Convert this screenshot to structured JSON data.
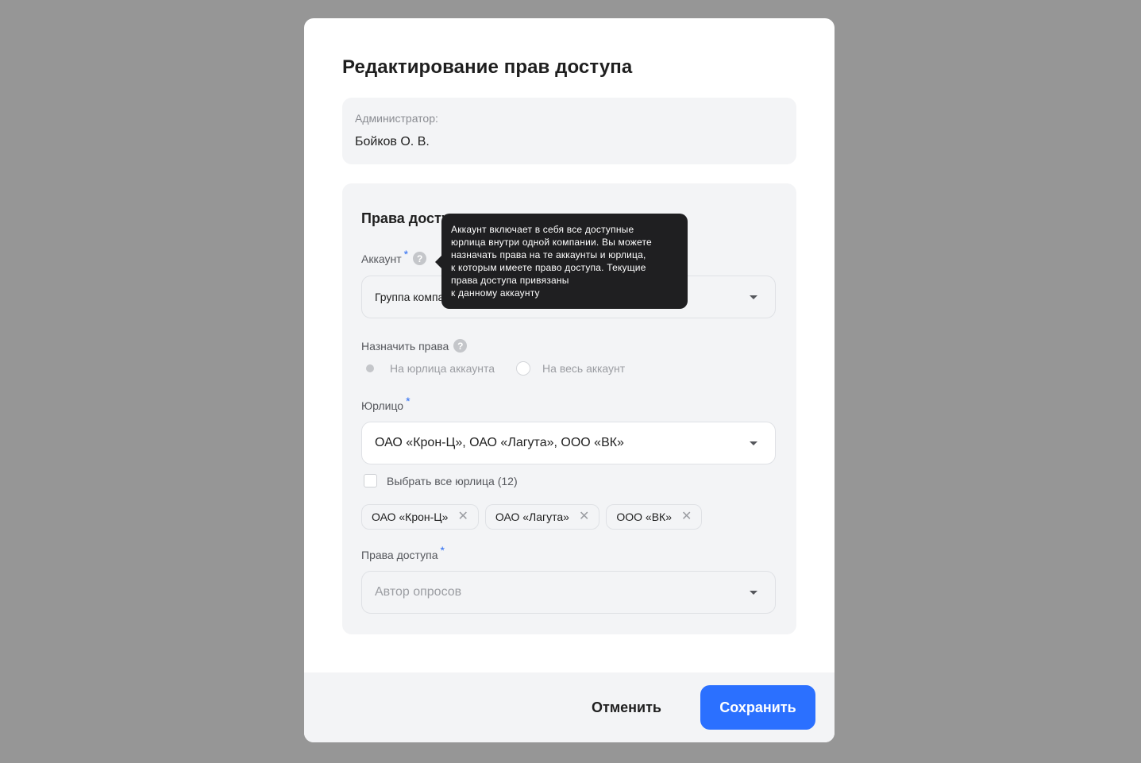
{
  "modal": {
    "title": "Редактирование прав доступа",
    "admin": {
      "label": "Администратор:",
      "value": "Бойков О. В."
    },
    "rights": {
      "section_title": "Права доступа",
      "account": {
        "label": "Аккаунт",
        "required_mark": "*",
        "help": "?",
        "value": "Группа компаний"
      },
      "assign": {
        "label": "Назначить права",
        "help": "?",
        "options": [
          "На юрлица аккаунта",
          "На весь аккаунт"
        ],
        "selected": "На юрлица аккаунта"
      },
      "legal_entity": {
        "label": "Юрлицо",
        "required_mark": "*",
        "value": "ОАО «Крон-Ц», ОАО «Лагута», ООО «ВК»",
        "select_all": "Выбрать все юрлица (12)",
        "chips": [
          "ОАО «Крон-Ц»",
          "ОАО «Лагута»",
          "ООО «ВК»"
        ],
        "chip_remove": "✕"
      },
      "access": {
        "label": "Права доступа",
        "required_mark": "*",
        "placeholder": "Автор опросов"
      }
    },
    "tooltip": {
      "lines": [
        "Аккаунт включает в себя все доступные",
        "юрлица внутри одной компании. Вы можете",
        "назначать права на те аккаунты и юрлица,",
        "к которым имеете право доступа. Текущие",
        "права доступа привязаны",
        "к данному аккаунту"
      ]
    },
    "footer": {
      "cancel": "Отменить",
      "save": "Сохранить"
    }
  },
  "colors": {
    "overlay": "#969696",
    "accent": "#2b70ff",
    "card": "#f3f4f6",
    "tooltip": "#1f1f21"
  }
}
